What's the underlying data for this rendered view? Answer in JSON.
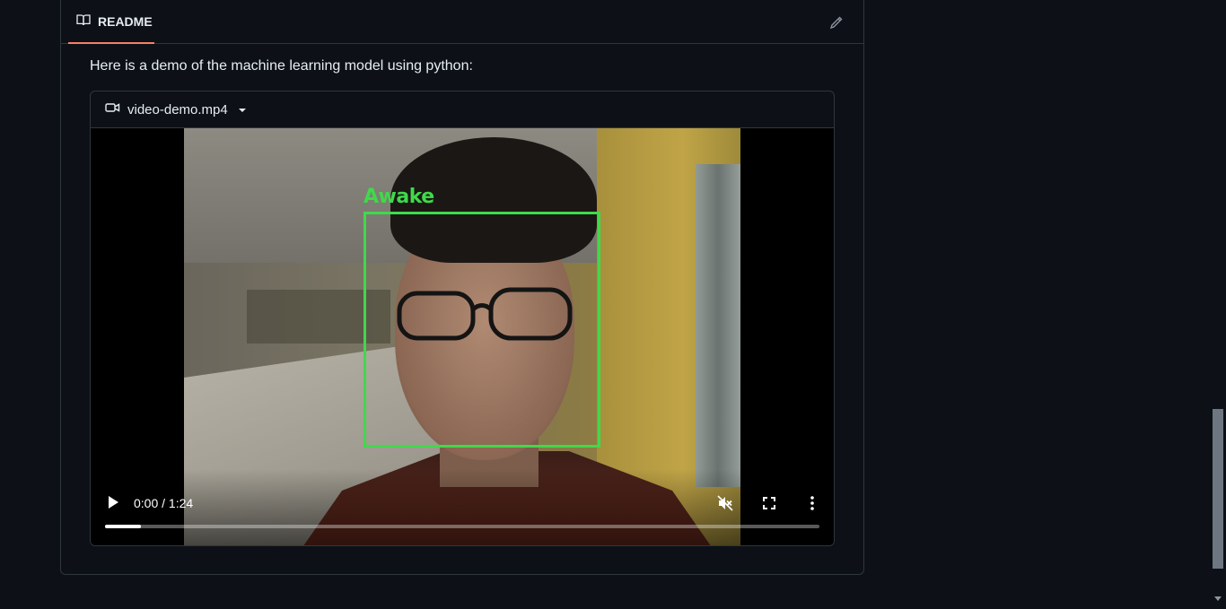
{
  "readme": {
    "tab_label": "README",
    "edit_icon": "pencil-icon",
    "intro_text": "Here is a demo of the machine learning model using python:"
  },
  "video": {
    "file_icon": "video-icon",
    "filename": "video-demo.mp4",
    "detection_label": "Awake",
    "detection_color": "#40d94a",
    "time": "0:00 / 1:24",
    "progress": 0.05,
    "controls": {
      "play": "play-icon",
      "mute": "muted-volume-icon",
      "fullscreen": "fullscreen-icon",
      "more": "more-vertical-icon"
    }
  },
  "colors": {
    "background": "#0d1117",
    "border": "#30363d",
    "tab_underline": "#f78166",
    "text": "#e6edf3"
  }
}
